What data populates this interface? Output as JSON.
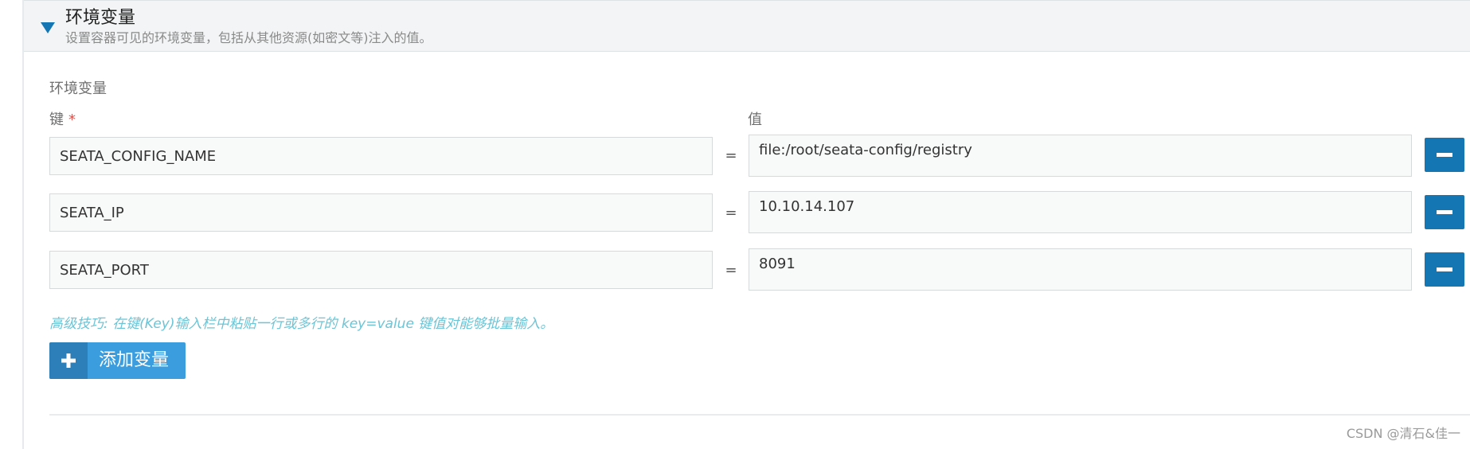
{
  "panel": {
    "title": "环境变量",
    "description": "设置容器可见的环境变量，包括从其他资源(如密文等)注入的值。"
  },
  "section_label": "环境变量",
  "columns": {
    "key_label": "键",
    "required_mark": "*",
    "value_label": "值"
  },
  "rows": [
    {
      "key": "SEATA_CONFIG_NAME",
      "equals": "=",
      "value": "file:/root/seata-config/registry"
    },
    {
      "key": "SEATA_IP",
      "equals": "=",
      "value": "10.10.14.107"
    },
    {
      "key": "SEATA_PORT",
      "equals": "=",
      "value": "8091"
    }
  ],
  "tip": "高级技巧: 在键(Key)输入栏中粘贴一行或多行的 key=value 键值对能够批量输入。",
  "add_button_label": "添加变量",
  "watermark": "CSDN @清石&佳一",
  "colors": {
    "accent": "#1576b4",
    "add_button": "#3b9ddd",
    "tip_text": "#6cc4d5",
    "required": "#d9534f"
  },
  "icons": {
    "toggle": "triangle-down-icon",
    "remove": "minus-icon",
    "add": "plus-icon"
  }
}
